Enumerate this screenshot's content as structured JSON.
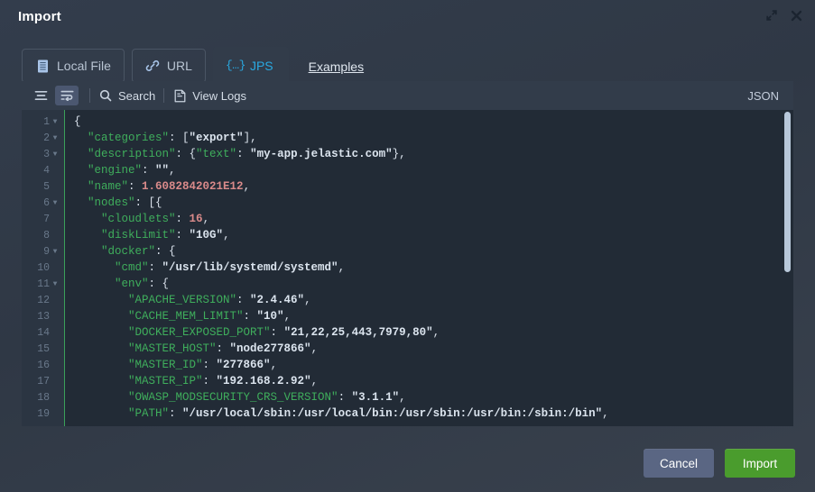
{
  "dialog": {
    "title": "Import",
    "expand_icon": "expand-icon",
    "close_icon": "close-icon"
  },
  "tabs": [
    {
      "label": "Local File",
      "icon": "file-icon",
      "active": false
    },
    {
      "label": "URL",
      "icon": "link-icon",
      "active": false
    },
    {
      "label": "JPS",
      "icon": "{…}",
      "active": true
    }
  ],
  "examples_link": "Examples",
  "toolbar": {
    "menu_icon": "list-lines-icon",
    "wrap_icon": "word-wrap-icon",
    "search_label": "Search",
    "search_icon": "search-icon",
    "view_logs_label": "View Logs",
    "view_logs_icon": "document-icon",
    "format_label": "JSON"
  },
  "editor": {
    "lines": [
      {
        "n": 1,
        "fold": true,
        "tokens": [
          {
            "t": "punct",
            "v": "{"
          }
        ]
      },
      {
        "n": 2,
        "fold": true,
        "tokens": [
          {
            "t": "key",
            "v": "  \"categories\""
          },
          {
            "t": "punct",
            "v": ": ["
          },
          {
            "t": "str",
            "v": "\"export\""
          },
          {
            "t": "punct",
            "v": "],"
          }
        ]
      },
      {
        "n": 3,
        "fold": true,
        "tokens": [
          {
            "t": "key",
            "v": "  \"description\""
          },
          {
            "t": "punct",
            "v": ": {"
          },
          {
            "t": "key",
            "v": "\"text\""
          },
          {
            "t": "punct",
            "v": ": "
          },
          {
            "t": "str",
            "v": "\"my-app.jelastic.com\""
          },
          {
            "t": "punct",
            "v": "},"
          }
        ]
      },
      {
        "n": 4,
        "fold": false,
        "tokens": [
          {
            "t": "key",
            "v": "  \"engine\""
          },
          {
            "t": "punct",
            "v": ": "
          },
          {
            "t": "str",
            "v": "\"\""
          },
          {
            "t": "punct",
            "v": ","
          }
        ]
      },
      {
        "n": 5,
        "fold": false,
        "tokens": [
          {
            "t": "key",
            "v": "  \"name\""
          },
          {
            "t": "punct",
            "v": ": "
          },
          {
            "t": "num",
            "v": "1.6082842021E12"
          },
          {
            "t": "punct",
            "v": ","
          }
        ]
      },
      {
        "n": 6,
        "fold": true,
        "tokens": [
          {
            "t": "key",
            "v": "  \"nodes\""
          },
          {
            "t": "punct",
            "v": ": [{"
          }
        ]
      },
      {
        "n": 7,
        "fold": false,
        "tokens": [
          {
            "t": "key",
            "v": "    \"cloudlets\""
          },
          {
            "t": "punct",
            "v": ": "
          },
          {
            "t": "num",
            "v": "16"
          },
          {
            "t": "punct",
            "v": ","
          }
        ]
      },
      {
        "n": 8,
        "fold": false,
        "tokens": [
          {
            "t": "key",
            "v": "    \"diskLimit\""
          },
          {
            "t": "punct",
            "v": ": "
          },
          {
            "t": "str",
            "v": "\"10G\""
          },
          {
            "t": "punct",
            "v": ","
          }
        ]
      },
      {
        "n": 9,
        "fold": true,
        "tokens": [
          {
            "t": "key",
            "v": "    \"docker\""
          },
          {
            "t": "punct",
            "v": ": {"
          }
        ]
      },
      {
        "n": 10,
        "fold": false,
        "tokens": [
          {
            "t": "key",
            "v": "      \"cmd\""
          },
          {
            "t": "punct",
            "v": ": "
          },
          {
            "t": "str",
            "v": "\"/usr/lib/systemd/systemd\""
          },
          {
            "t": "punct",
            "v": ","
          }
        ]
      },
      {
        "n": 11,
        "fold": true,
        "tokens": [
          {
            "t": "key",
            "v": "      \"env\""
          },
          {
            "t": "punct",
            "v": ": {"
          }
        ]
      },
      {
        "n": 12,
        "fold": false,
        "tokens": [
          {
            "t": "key",
            "v": "        \"APACHE_VERSION\""
          },
          {
            "t": "punct",
            "v": ": "
          },
          {
            "t": "str",
            "v": "\"2.4.46\""
          },
          {
            "t": "punct",
            "v": ","
          }
        ]
      },
      {
        "n": 13,
        "fold": false,
        "tokens": [
          {
            "t": "key",
            "v": "        \"CACHE_MEM_LIMIT\""
          },
          {
            "t": "punct",
            "v": ": "
          },
          {
            "t": "str",
            "v": "\"10\""
          },
          {
            "t": "punct",
            "v": ","
          }
        ]
      },
      {
        "n": 14,
        "fold": false,
        "tokens": [
          {
            "t": "key",
            "v": "        \"DOCKER_EXPOSED_PORT\""
          },
          {
            "t": "punct",
            "v": ": "
          },
          {
            "t": "str",
            "v": "\"21,22,25,443,7979,80\""
          },
          {
            "t": "punct",
            "v": ","
          }
        ]
      },
      {
        "n": 15,
        "fold": false,
        "tokens": [
          {
            "t": "key",
            "v": "        \"MASTER_HOST\""
          },
          {
            "t": "punct",
            "v": ": "
          },
          {
            "t": "str",
            "v": "\"node277866\""
          },
          {
            "t": "punct",
            "v": ","
          }
        ]
      },
      {
        "n": 16,
        "fold": false,
        "tokens": [
          {
            "t": "key",
            "v": "        \"MASTER_ID\""
          },
          {
            "t": "punct",
            "v": ": "
          },
          {
            "t": "str",
            "v": "\"277866\""
          },
          {
            "t": "punct",
            "v": ","
          }
        ]
      },
      {
        "n": 17,
        "fold": false,
        "tokens": [
          {
            "t": "key",
            "v": "        \"MASTER_IP\""
          },
          {
            "t": "punct",
            "v": ": "
          },
          {
            "t": "str",
            "v": "\"192.168.2.92\""
          },
          {
            "t": "punct",
            "v": ","
          }
        ]
      },
      {
        "n": 18,
        "fold": false,
        "tokens": [
          {
            "t": "key",
            "v": "        \"OWASP_MODSECURITY_CRS_VERSION\""
          },
          {
            "t": "punct",
            "v": ": "
          },
          {
            "t": "str",
            "v": "\"3.1.1\""
          },
          {
            "t": "punct",
            "v": ","
          }
        ]
      },
      {
        "n": 19,
        "fold": false,
        "tokens": [
          {
            "t": "key",
            "v": "        \"PATH\""
          },
          {
            "t": "punct",
            "v": ": "
          },
          {
            "t": "str",
            "v": "\"/usr/local/sbin:/usr/local/bin:/usr/sbin:/usr/bin:/sbin:/bin\""
          },
          {
            "t": "punct",
            "v": ","
          }
        ]
      }
    ]
  },
  "footer": {
    "cancel_label": "Cancel",
    "import_label": "Import"
  },
  "colors": {
    "dialog_bg": "#2f3845",
    "panel_bg": "#323c4a",
    "code_bg": "#222b36",
    "gutter_bg": "#2b3542",
    "accent_cyan": "#29a9e1",
    "key_green": "#3fae5c",
    "string": "#dbe4ee",
    "number": "#d98a8a",
    "cancel_btn": "#5a6683",
    "import_btn": "#4a9c2d",
    "scrollbar_thumb": "#b8c8da"
  }
}
